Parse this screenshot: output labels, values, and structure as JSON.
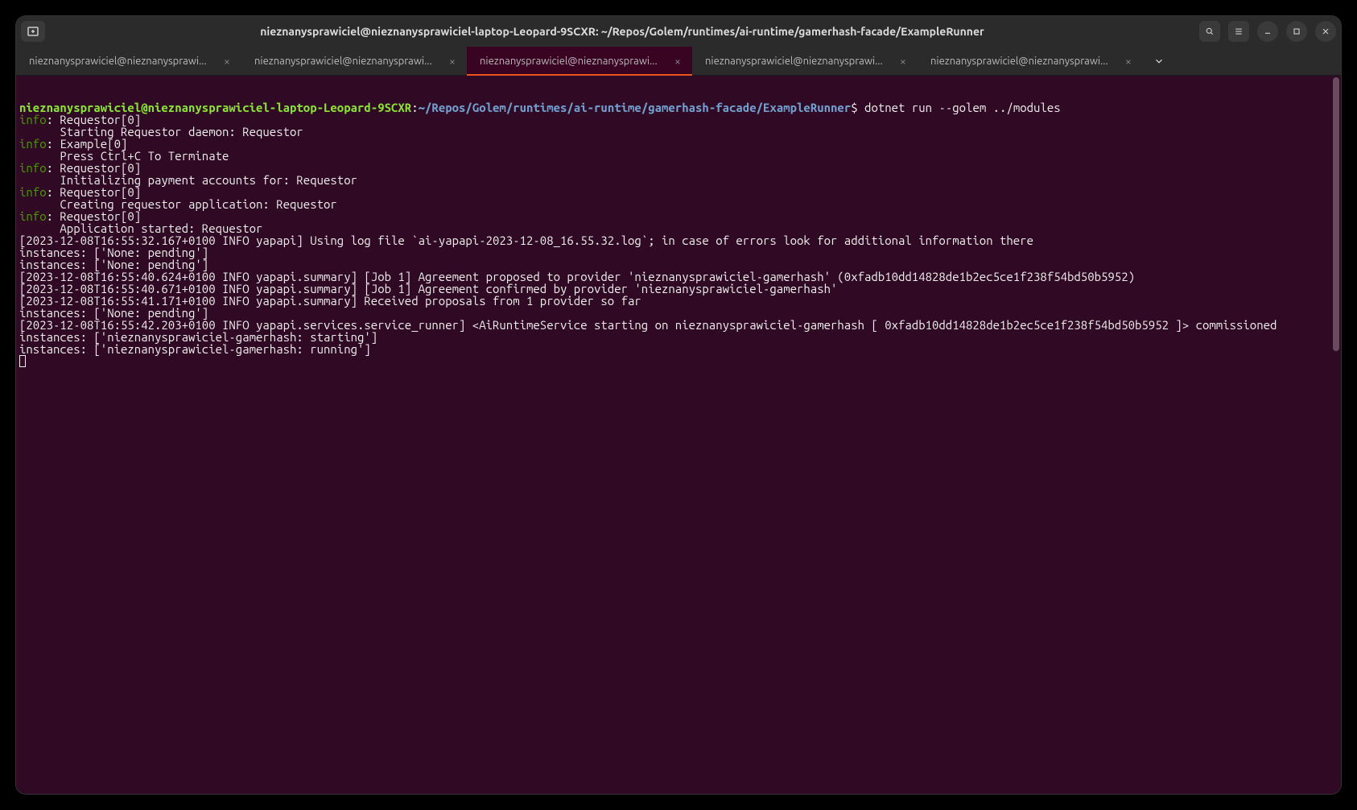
{
  "window": {
    "title": "nieznanysprawiciel@nieznanysprawiciel-laptop-Leopard-9SCXR: ~/Repos/Golem/runtimes/ai-runtime/gamerhash-facade/ExampleRunner"
  },
  "tabs": [
    {
      "label": "nieznanysprawiciel@nieznanysprawi..."
    },
    {
      "label": "nieznanysprawiciel@nieznanysprawi..."
    },
    {
      "label": "nieznanysprawiciel@nieznanysprawi..."
    },
    {
      "label": "nieznanysprawiciel@nieznanysprawi..."
    },
    {
      "label": "nieznanysprawiciel@nieznanysprawi..."
    }
  ],
  "activeTabIndex": 2,
  "prompt": {
    "userhost": "nieznanysprawiciel@nieznanysprawiciel-laptop-Leopard-9SCXR",
    "colon": ":",
    "path": "~/Repos/Golem/runtimes/ai-runtime/gamerhash-facade/ExampleRunner",
    "dollar": "$",
    "command": " dotnet run --golem ../modules"
  },
  "log": {
    "infoLabel": "info",
    "lines": [
      {
        "type": "info",
        "head": ": Requestor[0]",
        "body": "      Starting Requestor daemon: Requestor"
      },
      {
        "type": "info",
        "head": ": Example[0]",
        "body": "      Press Ctrl+C To Terminate"
      },
      {
        "type": "info",
        "head": ": Requestor[0]",
        "body": "      Initializing payment accounts for: Requestor"
      },
      {
        "type": "info",
        "head": ": Requestor[0]",
        "body": "      Creating requestor application: Requestor"
      },
      {
        "type": "info",
        "head": ": Requestor[0]",
        "body": "      Application started: Requestor"
      }
    ],
    "plain": [
      "[2023-12-08T16:55:32.167+0100 INFO yapapi] Using log file `ai-yapapi-2023-12-08_16.55.32.log`; in case of errors look for additional information there",
      "instances: ['None: pending']",
      "instances: ['None: pending']",
      "[2023-12-08T16:55:40.624+0100 INFO yapapi.summary] [Job 1] Agreement proposed to provider 'nieznanysprawiciel-gamerhash' (0xfadb10dd14828de1b2ec5ce1f238f54bd50b5952)",
      "[2023-12-08T16:55:40.671+0100 INFO yapapi.summary] [Job 1] Agreement confirmed by provider 'nieznanysprawiciel-gamerhash'",
      "[2023-12-08T16:55:41.171+0100 INFO yapapi.summary] Received proposals from 1 provider so far",
      "instances: ['None: pending']",
      "[2023-12-08T16:55:42.203+0100 INFO yapapi.services.service_runner] <AiRuntimeService starting on nieznanysprawiciel-gamerhash [ 0xfadb10dd14828de1b2ec5ce1f238f54bd50b5952 ]> commissioned",
      "instances: ['nieznanysprawiciel-gamerhash: starting']",
      "instances: ['nieznanysprawiciel-gamerhash: running']"
    ]
  }
}
